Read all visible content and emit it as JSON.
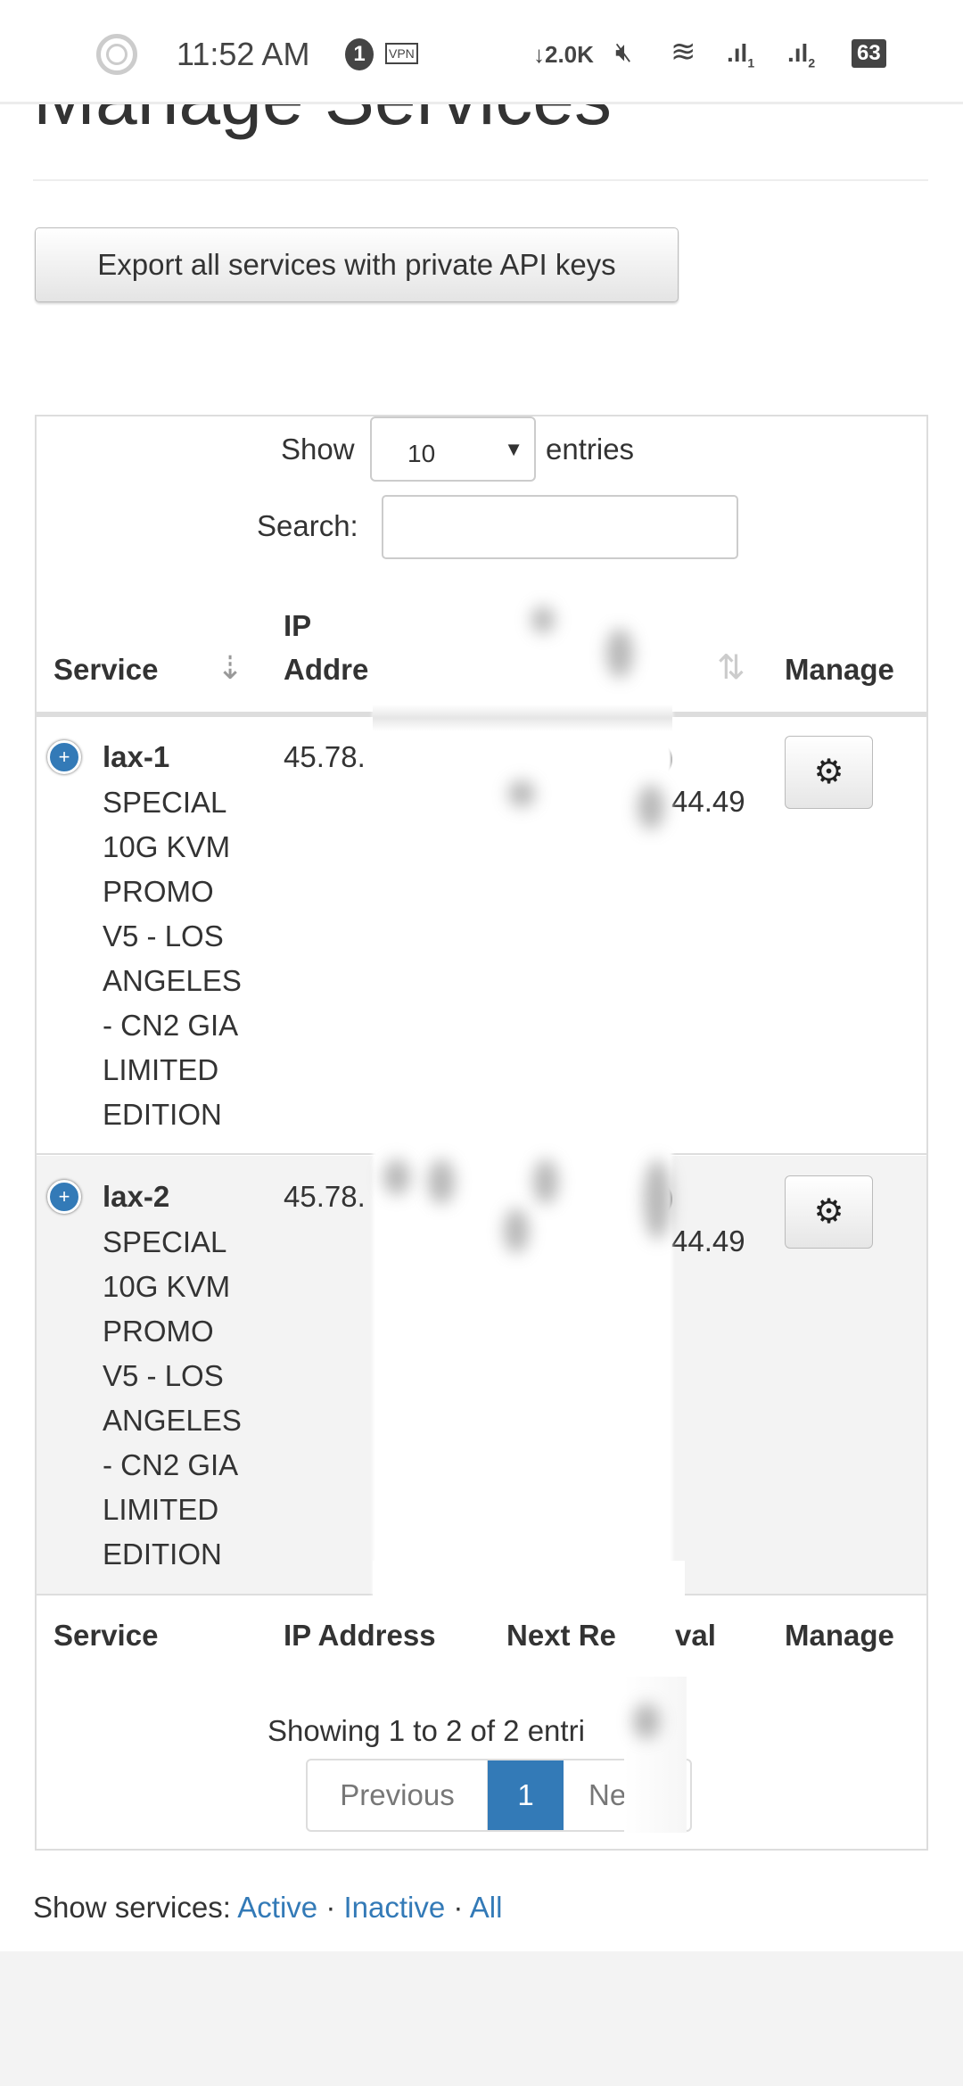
{
  "status_bar": {
    "time": "11:52 AM",
    "notification_count": "1",
    "vpn": "VPN",
    "net_speed": "↓2.0K",
    "battery": "63",
    "sim1": "1",
    "sim2": "2"
  },
  "page": {
    "title": "Manage Services",
    "export_button": "Export all services with private API keys"
  },
  "table_controls": {
    "show_label": "Show",
    "entries_value": "10",
    "entries_label": "entries",
    "search_label": "Search:",
    "search_value": ""
  },
  "header": {
    "service": "Service",
    "ip_line1": "IP",
    "ip_line2_visible": "Addre",
    "manage": "Manage"
  },
  "rows": [
    {
      "name": "lax-1",
      "desc": [
        "SPECIAL",
        "10G KVM",
        "PROMO",
        "V5 - LOS",
        "ANGELES",
        "- CN2 GIA",
        "LIMITED",
        "EDITION"
      ],
      "ip_visible": "45.78.",
      "renewal_fragment": ")",
      "ip_tail": "44.49"
    },
    {
      "name": "lax-2",
      "desc": [
        "SPECIAL",
        "10G KVM",
        "PROMO",
        "V5 - LOS",
        "ANGELES",
        "- CN2 GIA",
        "LIMITED",
        "EDITION"
      ],
      "ip_visible": "45.78.",
      "renewal_fragment": ")",
      "ip_tail": "44.49"
    }
  ],
  "footer_header": {
    "service": "Service",
    "ip": "IP Address",
    "next_renewal_start": "Next Re",
    "next_renewal_end": "val",
    "manage": "Manage"
  },
  "info": "Showing 1 to 2 of 2 entri",
  "pagination": {
    "previous": "Previous",
    "current": "1",
    "next_visible": "Ne"
  },
  "show_services": {
    "label": "Show services:",
    "active": "Active",
    "inactive": "Inactive",
    "all": "All",
    "sep": "·"
  },
  "colors": {
    "primary": "#337ab7",
    "text": "#333333",
    "striped_row": "#f3f3f3"
  }
}
